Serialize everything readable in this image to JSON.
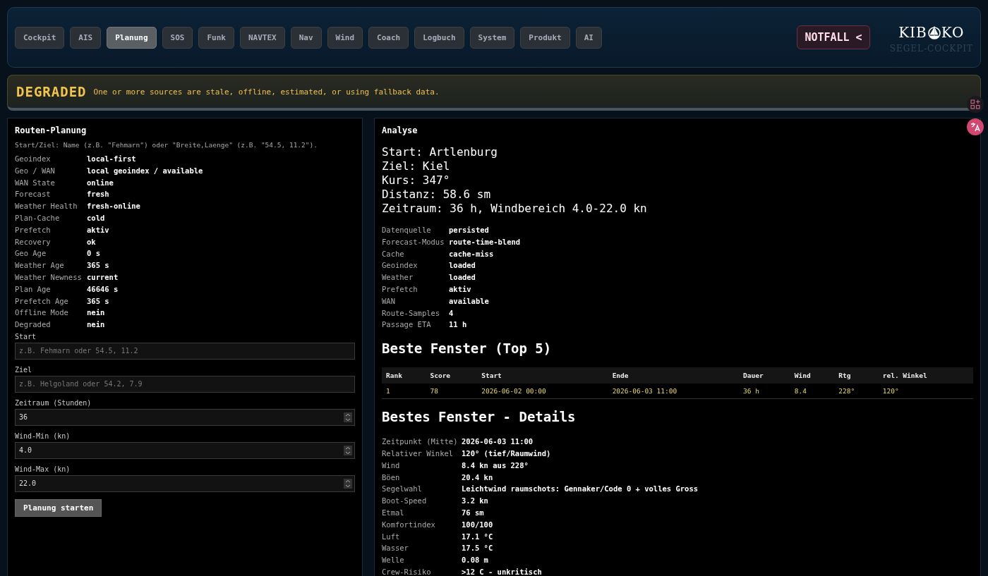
{
  "nav": {
    "tabs": [
      {
        "label": "Cockpit",
        "selected": false
      },
      {
        "label": "AIS",
        "selected": false
      },
      {
        "label": "Planung",
        "selected": true
      },
      {
        "label": "SOS",
        "selected": false
      },
      {
        "label": "Funk",
        "selected": false
      },
      {
        "label": "NAVTEX",
        "selected": false
      },
      {
        "label": "Nav",
        "selected": false
      },
      {
        "label": "Wind",
        "selected": false
      },
      {
        "label": "Coach",
        "selected": false
      },
      {
        "label": "Logbuch",
        "selected": false
      },
      {
        "label": "System",
        "selected": false
      },
      {
        "label": "Produkt",
        "selected": false
      },
      {
        "label": "AI",
        "selected": false
      }
    ],
    "emergency_button": "NOTFALL <",
    "logo": {
      "before": "KIB",
      "after": "KO",
      "subtitle": "SEGEL-COCKPIT"
    }
  },
  "banner": {
    "status": "DEGRADED",
    "message": "One or more sources are stale, offline, estimated, or using fallback data."
  },
  "planning": {
    "title": "Routen-Planung",
    "hint": "Start/Ziel: Name (z.B. \"Fehmarn\") oder \"Breite,Laenge\" (z.B. \"54.5, 11.2\").",
    "status": [
      {
        "label": "Geoindex",
        "value": "local-first"
      },
      {
        "label": "Geo / WAN",
        "value": "local geoindex / available"
      },
      {
        "label": "WAN State",
        "value": "online"
      },
      {
        "label": "Forecast",
        "value": "fresh"
      },
      {
        "label": "Weather Health",
        "value": "fresh-online"
      },
      {
        "label": "Plan-Cache",
        "value": "cold"
      },
      {
        "label": "Prefetch",
        "value": "aktiv"
      },
      {
        "label": "Recovery",
        "value": "ok"
      },
      {
        "label": "Geo Age",
        "value": "0 s"
      },
      {
        "label": "Weather Age",
        "value": "365 s"
      },
      {
        "label": "Weather Newness",
        "value": "current"
      },
      {
        "label": "Plan Age",
        "value": "46646 s"
      },
      {
        "label": "Prefetch Age",
        "value": "365 s"
      },
      {
        "label": "Offline Mode",
        "value": "nein"
      },
      {
        "label": "Degraded",
        "value": "nein"
      }
    ],
    "fields": [
      {
        "kind": "text",
        "label": "Start",
        "placeholder": "z.B. Fehmarn oder 54.5, 11.2"
      },
      {
        "kind": "text",
        "label": "Ziel",
        "placeholder": "z.B. Helgoland oder 54.2, 7.9"
      },
      {
        "kind": "number",
        "label": "Zeitraum (Stunden)",
        "value": "36"
      },
      {
        "kind": "number",
        "label": "Wind-Min (kn)",
        "value": "4.0"
      },
      {
        "kind": "number",
        "label": "Wind-Max (kn)",
        "value": "22.0"
      }
    ],
    "submit_button": "Planung starten"
  },
  "analysis": {
    "title": "Analyse",
    "summary": [
      "Start: Artlenburg",
      "Ziel: Kiel",
      "Kurs: 347°",
      "Distanz: 58.6 sm",
      "Zeitraum: 36 h, Windbereich 4.0-22.0 kn"
    ],
    "meta": [
      {
        "label": "Datenquelle",
        "value": "persisted"
      },
      {
        "label": "Forecast-Modus",
        "value": "route-time-blend"
      },
      {
        "label": "Cache",
        "value": "cache-miss"
      },
      {
        "label": "Geoindex",
        "value": "loaded"
      },
      {
        "label": "Weather",
        "value": "loaded"
      },
      {
        "label": "Prefetch",
        "value": "aktiv"
      },
      {
        "label": "WAN",
        "value": "available"
      },
      {
        "label": "Route-Samples",
        "value": "4"
      },
      {
        "label": "Passage ETA",
        "value": "11 h"
      }
    ],
    "windows_title": "Beste Fenster (Top 5)",
    "windows_table": {
      "columns": [
        "Rank",
        "Score",
        "Start",
        "Ende",
        "Dauer",
        "Wind",
        "Rtg",
        "rel. Winkel"
      ],
      "rows": [
        [
          "1",
          "78",
          "2026-06-02 00:00",
          "2026-06-03 11:00",
          "36 h",
          "8.4",
          "228°",
          "120°"
        ]
      ]
    },
    "details_title": "Bestes Fenster - Details",
    "details": [
      {
        "label": "Zeitpunkt (Mitte)",
        "value": "2026-06-03 11:00"
      },
      {
        "label": "Relativer Winkel",
        "value": "120° (tief/Raumwind)"
      },
      {
        "label": "Wind",
        "value": "8.4 kn aus 228°"
      },
      {
        "label": "Böen",
        "value": "20.4 kn"
      },
      {
        "label": "Segelwahl",
        "value": "Leichtwind raumschots: Gennaker/Code 0 + volles Gross"
      },
      {
        "label": "Boot-Speed",
        "value": "3.2 kn"
      },
      {
        "label": "Etmal",
        "value": "76 sm"
      },
      {
        "label": "Komfortindex",
        "value": "100/100"
      },
      {
        "label": "Luft",
        "value": "17.1 °C"
      },
      {
        "label": "Wasser",
        "value": "17.5 °C"
      },
      {
        "label": "Welle",
        "value": "0.08 m"
      },
      {
        "label": "Crew-Risiko",
        "value": ">12 C - unkritisch"
      }
    ]
  }
}
